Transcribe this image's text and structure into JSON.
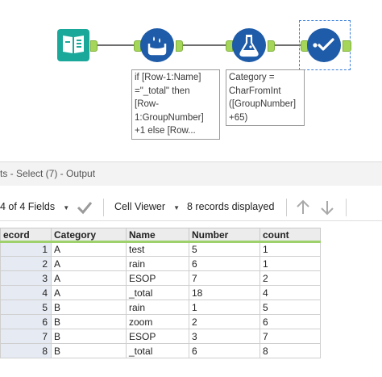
{
  "workflow": {
    "tools": [
      {
        "id": "input",
        "icon": "book-input-icon"
      },
      {
        "id": "multi-row",
        "icon": "multi-row-formula-icon"
      },
      {
        "id": "formula",
        "icon": "flask-formula-icon"
      },
      {
        "id": "select",
        "icon": "checkmark-select-icon"
      }
    ],
    "annotations": {
      "multi_row": "if [Row-1:Name]\n=\"_total\" then\n[Row-\n1:GroupNumber]\n+1 else [Row...",
      "formula": "Category =\nCharFromInt\n([GroupNumber]\n+65)"
    }
  },
  "results": {
    "header": "ts - Select (7) - Output",
    "toolbar": {
      "fields_label": "4 of 4 Fields",
      "viewer_label": "Cell Viewer",
      "records_label": "8 records displayed"
    },
    "columns": [
      "ecord",
      "Category",
      "Name",
      "Number",
      "count"
    ],
    "rows": [
      {
        "record": "1",
        "category": "A",
        "name": "test",
        "number": "5",
        "count": "1"
      },
      {
        "record": "2",
        "category": "A",
        "name": "rain",
        "number": "6",
        "count": "1"
      },
      {
        "record": "3",
        "category": "A",
        "name": "ESOP",
        "number": "7",
        "count": "2"
      },
      {
        "record": "4",
        "category": "A",
        "name": "_total",
        "number": "18",
        "count": "4"
      },
      {
        "record": "5",
        "category": "B",
        "name": "rain",
        "number": "1",
        "count": "5"
      },
      {
        "record": "6",
        "category": "B",
        "name": "zoom",
        "number": "2",
        "count": "6"
      },
      {
        "record": "7",
        "category": "B",
        "name": "ESOP",
        "number": "3",
        "count": "7"
      },
      {
        "record": "8",
        "category": "B",
        "name": "_total",
        "number": "6",
        "count": "8"
      }
    ]
  },
  "colors": {
    "tool_blue": "#1e5ba8",
    "input_teal": "#1aa89a",
    "anchor_green": "#a5d65a",
    "header_underline": "#9ed06b"
  }
}
